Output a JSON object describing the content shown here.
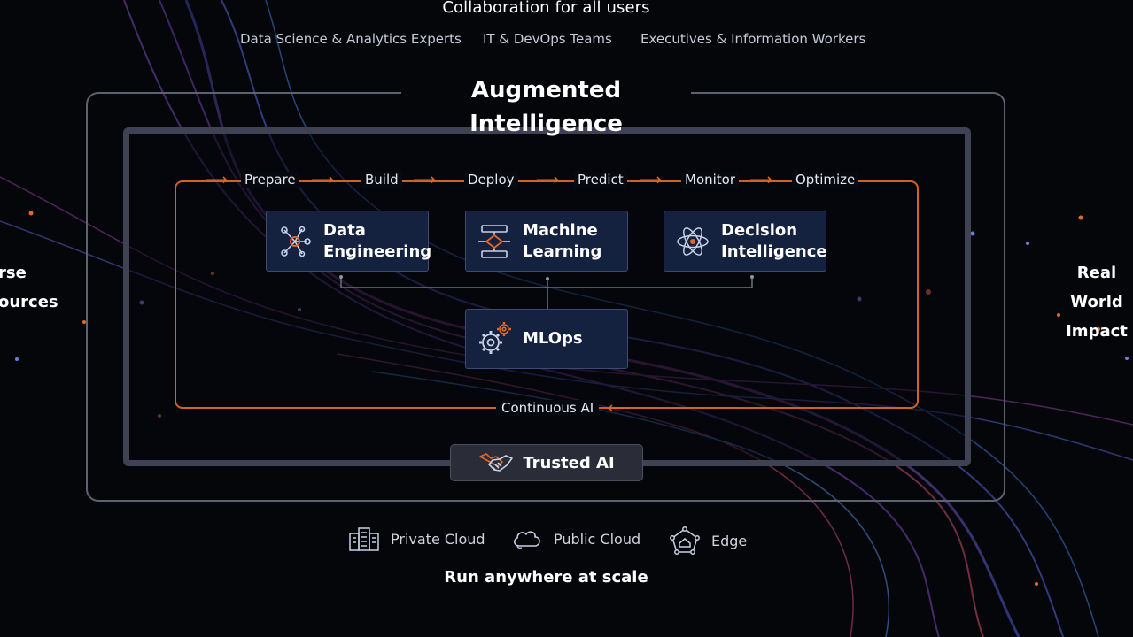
{
  "header": {
    "title": "Collaboration for all users",
    "audiences": [
      "Data Science & Analytics Experts",
      "IT & DevOps Teams",
      "Executives & Information Workers"
    ]
  },
  "main": {
    "title": "Augmented Intelligence",
    "stages": [
      "Prepare",
      "Build",
      "Deploy",
      "Predict",
      "Monitor",
      "Optimize"
    ],
    "cards": {
      "data_engineering": {
        "label": "Data\nEngineering",
        "icon": "network-nodes-icon"
      },
      "machine_learning": {
        "label": "Machine\nLearning",
        "icon": "flowchart-icon"
      },
      "decision_intelligence": {
        "label": "Decision\nIntelligence",
        "icon": "atom-icon"
      },
      "mlops": {
        "label": "MLOps",
        "icon": "gears-icon"
      }
    },
    "loop_label": "Continuous AI",
    "trusted": {
      "label": "Trusted AI",
      "icon": "handshake-icon"
    }
  },
  "sides": {
    "left": [
      "rse",
      "ources"
    ],
    "right": [
      "Real World",
      "Impact"
    ]
  },
  "deployment": {
    "items": [
      {
        "label": "Private Cloud",
        "icon": "building-icon"
      },
      {
        "label": "Public Cloud",
        "icon": "cloud-icon"
      },
      {
        "label": "Edge",
        "icon": "edge-network-icon"
      }
    ],
    "title": "Run anywhere at scale"
  },
  "colors": {
    "accent": "#e2672a",
    "card_bg": "#14213f",
    "card_border": "#3b4b75",
    "frame": "#5d6170"
  }
}
